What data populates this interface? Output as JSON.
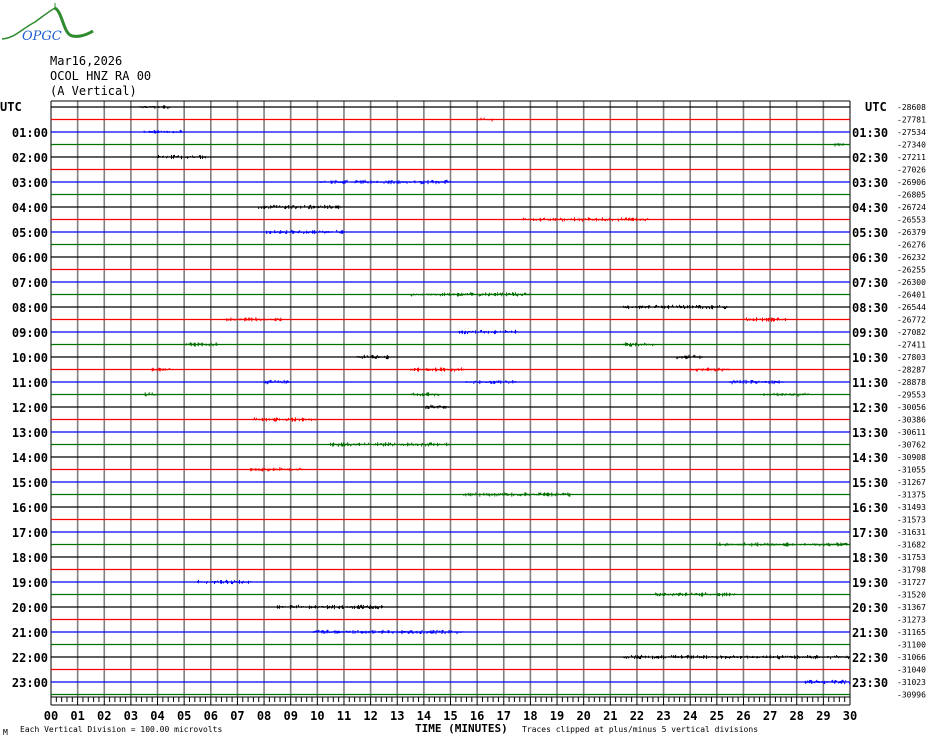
{
  "logo": {
    "text": "OPGC"
  },
  "header": {
    "date": "Mar16,2026",
    "station": "OCOL HNZ RA 00",
    "component": "(A Vertical)"
  },
  "colors": {
    "trace_cycle": [
      "#000000",
      "#ff0000",
      "#0000ff",
      "#007000"
    ],
    "grid": "#808080"
  },
  "chart_data": {
    "type": "line",
    "title": "OCOL HNZ RA 00 (A Vertical) helicorder",
    "xlabel": "TIME (MINUTES)",
    "xlim": [
      0,
      30
    ],
    "x_ticks": [
      "00",
      "01",
      "02",
      "03",
      "04",
      "05",
      "06",
      "07",
      "08",
      "09",
      "10",
      "11",
      "12",
      "13",
      "14",
      "15",
      "16",
      "17",
      "18",
      "19",
      "20",
      "21",
      "22",
      "23",
      "24",
      "25",
      "26",
      "27",
      "28",
      "29",
      "30"
    ],
    "left_label_header": "UTC",
    "right_label_header": "UTC",
    "left_labels": [
      "01:00",
      "02:00",
      "03:00",
      "04:00",
      "05:00",
      "06:00",
      "07:00",
      "08:00",
      "09:00",
      "10:00",
      "11:00",
      "12:00",
      "13:00",
      "14:00",
      "15:00",
      "16:00",
      "17:00",
      "18:00",
      "19:00",
      "20:00",
      "21:00",
      "22:00",
      "23:00"
    ],
    "right_labels": [
      "01:30",
      "02:30",
      "03:30",
      "04:30",
      "05:30",
      "06:30",
      "07:30",
      "08:30",
      "09:30",
      "10:30",
      "11:30",
      "12:30",
      "13:30",
      "14:30",
      "15:30",
      "16:30",
      "17:30",
      "18:30",
      "19:30",
      "20:30",
      "21:30",
      "22:30",
      "23:30"
    ],
    "row_offsets": [
      "-28608",
      "-27781",
      "-27534",
      "-27340",
      "-27211",
      "-27026",
      "-26906",
      "-26805",
      "-26724",
      "-26553",
      "-26379",
      "-26276",
      "-26232",
      "-26255",
      "-26300",
      "-26401",
      "-26544",
      "-26772",
      "-27082",
      "-27411",
      "-27803",
      "-28287",
      "-28878",
      "-29553",
      "-30056",
      "-30386",
      "-30611",
      "-30762",
      "-30908",
      "-31055",
      "-31267",
      "-31375",
      "-31493",
      "-31573",
      "-31631",
      "-31682",
      "-31753",
      "-31798",
      "-31727",
      "-31520",
      "-31367",
      "-31273",
      "-31165",
      "-31100",
      "-31066",
      "-31040",
      "-31023",
      "-30996"
    ],
    "events": [
      [
        0,
        3.3,
        4.5
      ],
      [
        1,
        16.0,
        16.6
      ],
      [
        2,
        3.5,
        4.9
      ],
      [
        3,
        29.4,
        29.8
      ],
      [
        4,
        4.0,
        5.9
      ],
      [
        6,
        10.1,
        15.0
      ],
      [
        8,
        7.8,
        10.9
      ],
      [
        9,
        17.7,
        22.5
      ],
      [
        10,
        8.1,
        11.0
      ],
      [
        15,
        13.5,
        18.0
      ],
      [
        16,
        21.5,
        25.5
      ],
      [
        17,
        6.6,
        8.7
      ],
      [
        17,
        26.0,
        27.6
      ],
      [
        18,
        15.3,
        17.5
      ],
      [
        19,
        5.0,
        6.3
      ],
      [
        19,
        21.5,
        22.7
      ],
      [
        20,
        11.5,
        12.7
      ],
      [
        20,
        23.5,
        24.5
      ],
      [
        21,
        3.8,
        4.5
      ],
      [
        21,
        13.5,
        15.5
      ],
      [
        21,
        24.0,
        25.5
      ],
      [
        22,
        8.0,
        9.0
      ],
      [
        22,
        15.5,
        17.5
      ],
      [
        22,
        25.5,
        27.5
      ],
      [
        23,
        3.5,
        4.0
      ],
      [
        23,
        13.5,
        14.6
      ],
      [
        23,
        26.7,
        28.5
      ],
      [
        24,
        14.0,
        15.0
      ],
      [
        25,
        7.6,
        10.0
      ],
      [
        27,
        10.5,
        15.0
      ],
      [
        29,
        7.5,
        9.5
      ],
      [
        31,
        15.5,
        19.5
      ],
      [
        35,
        25.0,
        30.0
      ],
      [
        38,
        5.5,
        7.5
      ],
      [
        39,
        22.7,
        25.7
      ],
      [
        40,
        8.5,
        12.5
      ],
      [
        42,
        9.8,
        15.5
      ],
      [
        44,
        21.5,
        30.0
      ],
      [
        46,
        28.3,
        30.0
      ]
    ]
  },
  "footer": {
    "corner_mark": "M",
    "scale_note": "Each Vertical Division =  100.00 microvolts",
    "xlabel": "TIME (MINUTES)",
    "clip_note": "Traces clipped at plus/minus 5 vertical divisions"
  }
}
